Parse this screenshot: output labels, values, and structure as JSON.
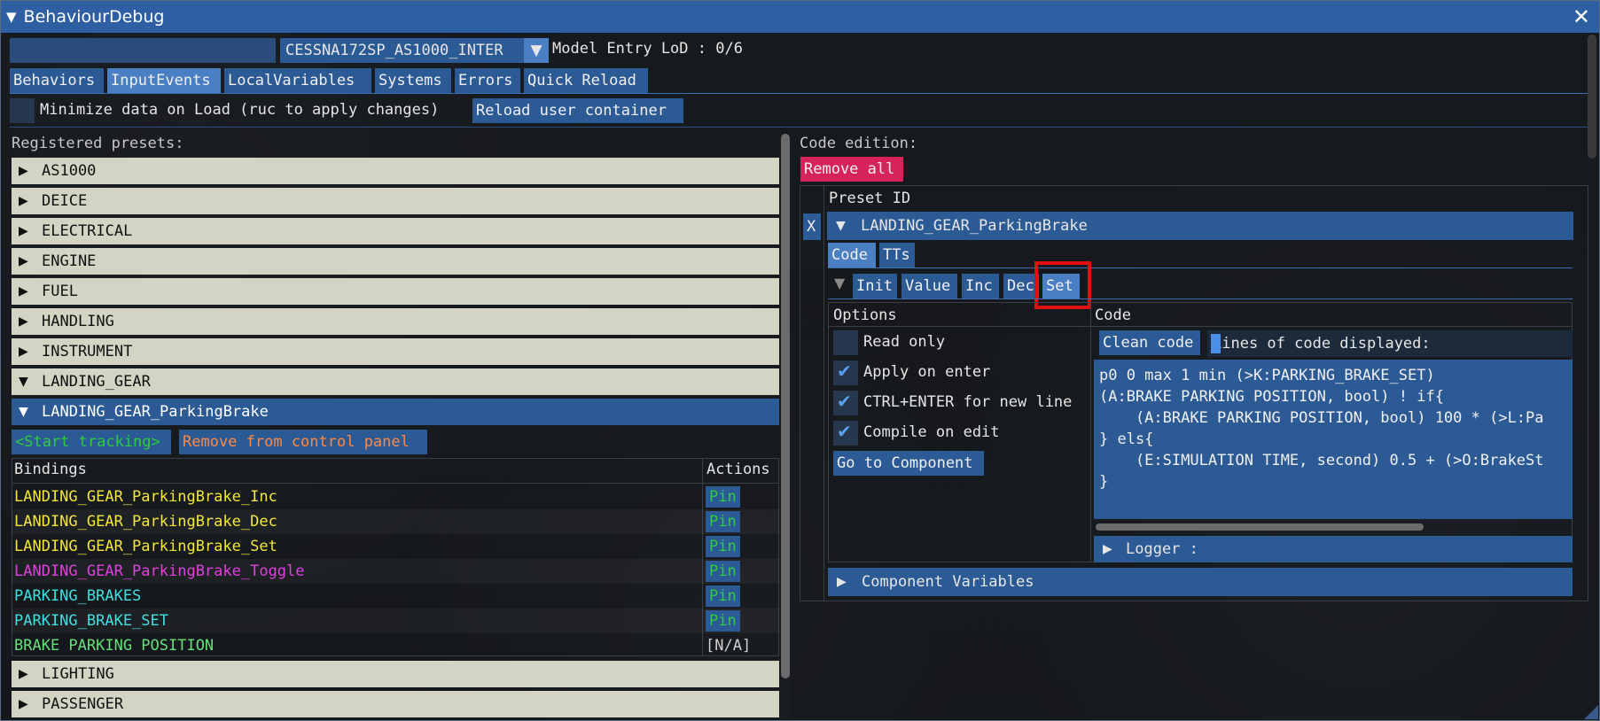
{
  "window": {
    "title": "BehaviourDebug"
  },
  "toolbar": {
    "model_select": "CESSNA172SP_AS1000_INTER",
    "lod_label": "Model Entry LoD : 0/6"
  },
  "tabs": [
    "Behaviors",
    "InputEvents",
    "LocalVariables",
    "Systems",
    "Errors",
    "Quick Reload"
  ],
  "options_row": {
    "minimize_label": "Minimize data on Load (ruc to apply changes)",
    "reload_button": "Reload user container"
  },
  "left": {
    "registered_label": "Registered presets:",
    "groups_top": [
      "AS1000",
      "DEICE",
      "ELECTRICAL",
      "ENGINE",
      "FUEL",
      "HANDLING",
      "INSTRUMENT",
      "LANDING_GEAR"
    ],
    "subgroup": "LANDING_GEAR_ParkingBrake",
    "start_tracking": "<Start tracking>",
    "remove_from_panel": "Remove from control panel",
    "bindings_header": "Bindings",
    "actions_header": "Actions",
    "bindings": [
      {
        "name": "LANDING_GEAR_ParkingBrake_Inc",
        "action": "Pin"
      },
      {
        "name": "LANDING_GEAR_ParkingBrake_Dec",
        "action": "Pin"
      },
      {
        "name": "LANDING_GEAR_ParkingBrake_Set",
        "action": "Pin"
      },
      {
        "name": "LANDING_GEAR_ParkingBrake_Toggle",
        "action": "Pin"
      },
      {
        "name": "PARKING_BRAKES",
        "action": "Pin"
      },
      {
        "name": "PARKING_BRAKE_SET",
        "action": "Pin"
      },
      {
        "name": "BRAKE PARKING POSITION",
        "action": "[N/A]"
      }
    ],
    "groups_bottom": [
      "LIGHTING",
      "PASSENGER"
    ]
  },
  "right": {
    "code_edition_label": "Code edition:",
    "remove_all": "Remove all",
    "preset_id_header": "Preset ID",
    "x_button": "X",
    "preset_name": "LANDING_GEAR_ParkingBrake",
    "subtabs": [
      "Code",
      "TTs"
    ],
    "code_tabs": [
      "Init",
      "Value",
      "Inc",
      "Dec",
      "Set"
    ],
    "options_header": "Options",
    "code_header": "Code",
    "options": [
      {
        "label": "Read only",
        "checked": false
      },
      {
        "label": "Apply on enter",
        "checked": true
      },
      {
        "label": "CTRL+ENTER for new line",
        "checked": true
      },
      {
        "label": "Compile on edit",
        "checked": true
      }
    ],
    "go_to_component": "Go to Component",
    "clean_code": "Clean code",
    "lines_displayed_label": "Lines of code displayed:",
    "code_text": "p0 0 max 1 min (>K:PARKING_BRAKE_SET)\n(A:BRAKE PARKING POSITION, bool) ! if{\n    (A:BRAKE PARKING POSITION, bool) 100 * (>L:Pa\n} els{\n    (E:SIMULATION TIME, second) 0.5 + (>O:BrakeSt\n}",
    "logger": "Logger :",
    "component_variables": "Component Variables"
  },
  "colors": {
    "titlebar": "#2f5fa3",
    "button": "#2c5a94",
    "active": "#4a7fc4",
    "remove_all": "#d6245a",
    "highlight": "#e01010"
  }
}
